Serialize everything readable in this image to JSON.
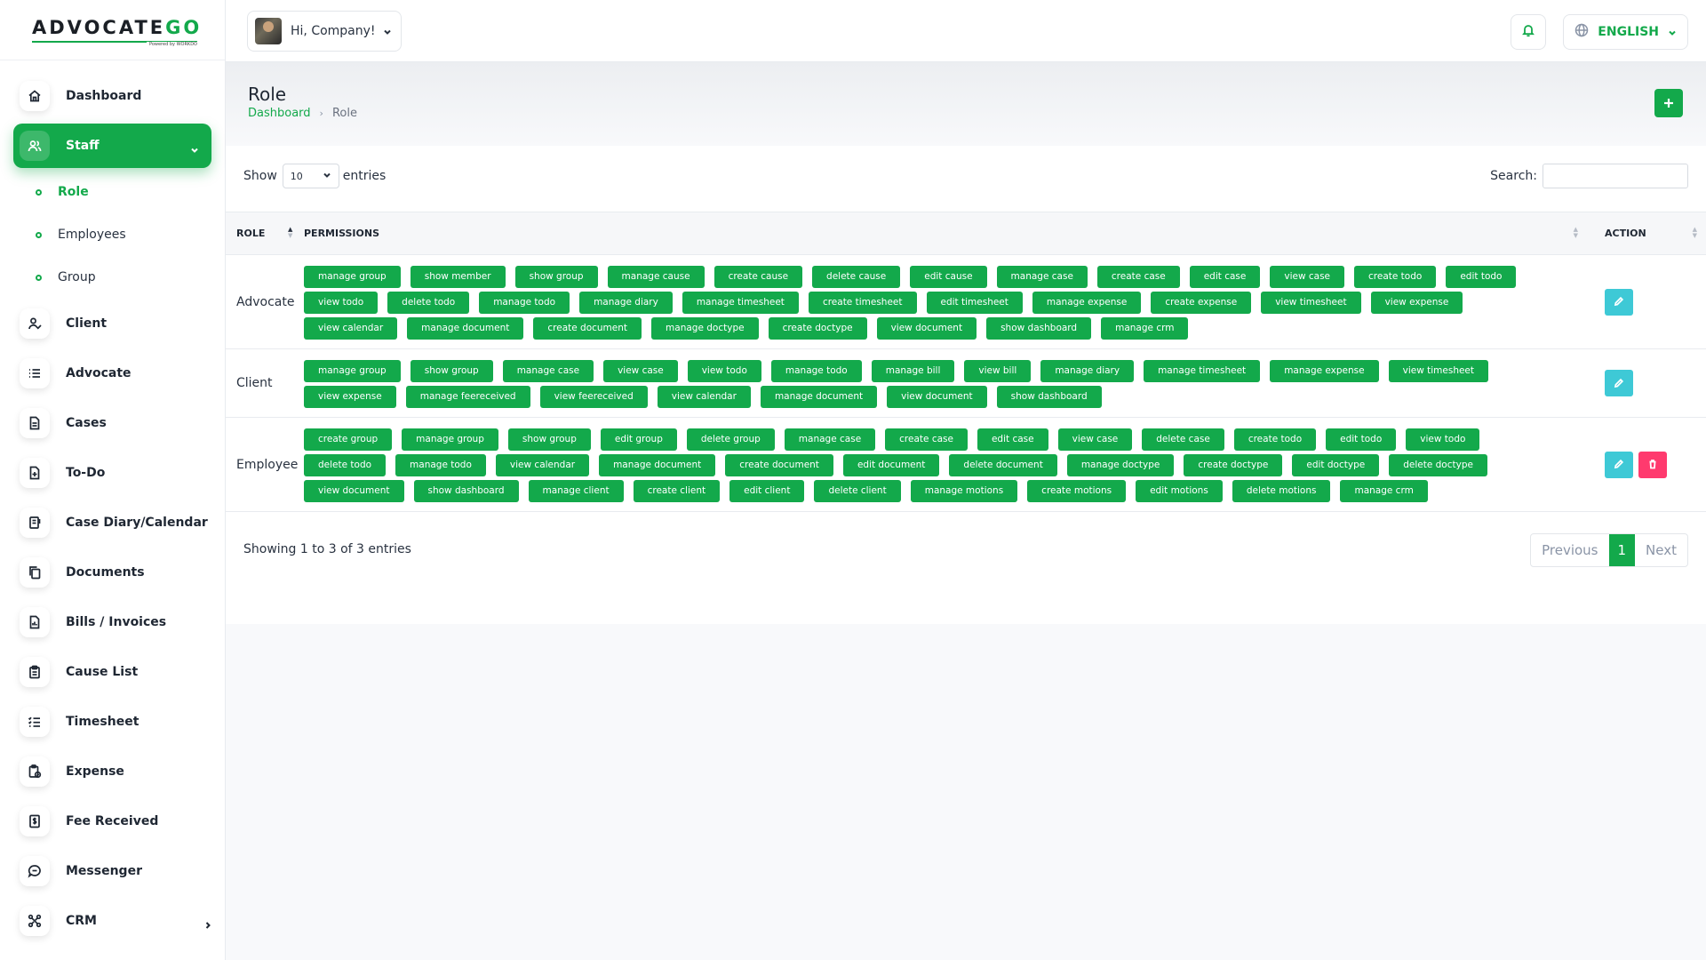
{
  "brand": {
    "logo_main": "ADVOCATE",
    "logo_accent": "GO",
    "logo_sub": "Powered by WORKDO"
  },
  "sidebar": {
    "items": [
      {
        "label": "Dashboard",
        "icon": "home-icon"
      },
      {
        "label": "Staff",
        "icon": "users-icon",
        "active": true
      },
      {
        "label": "Client",
        "icon": "user-check-icon"
      },
      {
        "label": "Advocate",
        "icon": "list-icon"
      },
      {
        "label": "Cases",
        "icon": "file-icon"
      },
      {
        "label": "To-Do",
        "icon": "file-plus-icon"
      },
      {
        "label": "Case Diary/Calendar",
        "icon": "notebook-icon"
      },
      {
        "label": "Documents",
        "icon": "copy-icon"
      },
      {
        "label": "Bills / Invoices",
        "icon": "invoice-icon"
      },
      {
        "label": "Cause List",
        "icon": "clipboard-icon"
      },
      {
        "label": "Timesheet",
        "icon": "checklist-icon"
      },
      {
        "label": "Expense",
        "icon": "receipt-icon"
      },
      {
        "label": "Fee Received",
        "icon": "dollar-icon"
      },
      {
        "label": "Messenger",
        "icon": "message-icon"
      },
      {
        "label": "CRM",
        "icon": "crm-icon"
      }
    ],
    "staff_sub": [
      {
        "label": "Role",
        "active": true
      },
      {
        "label": "Employees"
      },
      {
        "label": "Group"
      }
    ]
  },
  "header": {
    "greeting": "Hi, Company!",
    "language": "ENGLISH"
  },
  "page": {
    "title": "Role",
    "breadcrumb_home": "Dashboard",
    "breadcrumb_sep": "›",
    "breadcrumb_current": "Role"
  },
  "table_controls": {
    "show_label": "Show",
    "entries_value": "10",
    "entries_label": "entries",
    "search_label": "Search:"
  },
  "table": {
    "headers": {
      "role": "ROLE",
      "permissions": "PERMISSIONS",
      "action": "ACTION"
    },
    "rows": [
      {
        "role": "Advocate",
        "can_delete": false,
        "permissions": [
          "manage group",
          "show member",
          "show group",
          "manage cause",
          "create cause",
          "delete cause",
          "edit cause",
          "manage case",
          "create case",
          "edit case",
          "view case",
          "create todo",
          "edit todo",
          "view todo",
          "delete todo",
          "manage todo",
          "manage diary",
          "manage timesheet",
          "create timesheet",
          "edit timesheet",
          "manage expense",
          "create expense",
          "view timesheet",
          "view expense",
          "view calendar",
          "manage document",
          "create document",
          "manage doctype",
          "create doctype",
          "view document",
          "show dashboard",
          "manage crm"
        ]
      },
      {
        "role": "Client",
        "can_delete": false,
        "permissions": [
          "manage group",
          "show group",
          "manage case",
          "view case",
          "view todo",
          "manage todo",
          "manage bill",
          "view bill",
          "manage diary",
          "manage timesheet",
          "manage expense",
          "view timesheet",
          "view expense",
          "manage feereceived",
          "view feereceived",
          "view calendar",
          "manage document",
          "view document",
          "show dashboard"
        ]
      },
      {
        "role": "Employee",
        "can_delete": true,
        "permissions": [
          "create group",
          "manage group",
          "show group",
          "edit group",
          "delete group",
          "manage case",
          "create case",
          "edit case",
          "view case",
          "delete case",
          "create todo",
          "edit todo",
          "view todo",
          "delete todo",
          "manage todo",
          "view calendar",
          "manage document",
          "create document",
          "edit document",
          "delete document",
          "manage doctype",
          "create doctype",
          "edit doctype",
          "delete doctype",
          "view document",
          "show dashboard",
          "manage client",
          "create client",
          "edit client",
          "delete client",
          "manage motions",
          "create motions",
          "edit motions",
          "delete motions",
          "manage crm"
        ]
      }
    ]
  },
  "footer": {
    "info": "Showing 1 to 3 of 3 entries",
    "prev": "Previous",
    "page": "1",
    "next": "Next"
  },
  "colors": {
    "accent": "#13a94b",
    "edit": "#3ec9d6",
    "delete": "#ff3a6e"
  }
}
